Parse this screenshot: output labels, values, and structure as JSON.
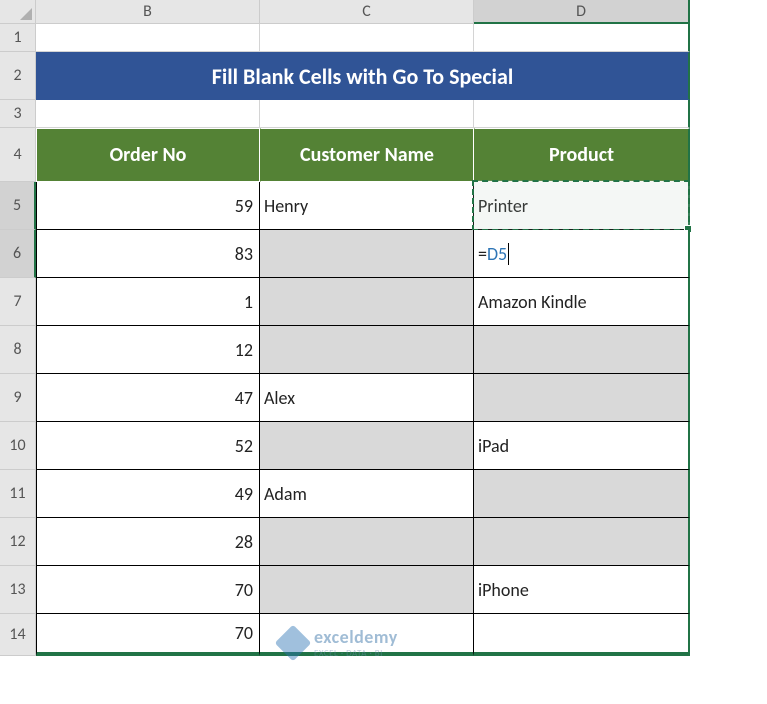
{
  "columns": [
    "B",
    "C",
    "D"
  ],
  "rows": [
    "1",
    "2",
    "3",
    "4",
    "5",
    "6",
    "7",
    "8",
    "9",
    "10",
    "11",
    "12",
    "13",
    "14"
  ],
  "title": "Fill Blank Cells with Go To Special",
  "headers": {
    "b": "Order No",
    "c": "Customer Name",
    "d": "Product"
  },
  "formula": {
    "eq": "=",
    "ref": "D5"
  },
  "data": {
    "r5": {
      "b": "59",
      "c": "Henry",
      "d": "Printer"
    },
    "r6": {
      "b": "83",
      "c": "",
      "d": ""
    },
    "r7": {
      "b": "1",
      "c": "",
      "d": "Amazon Kindle"
    },
    "r8": {
      "b": "12",
      "c": "",
      "d": ""
    },
    "r9": {
      "b": "47",
      "c": "Alex",
      "d": ""
    },
    "r10": {
      "b": "52",
      "c": "",
      "d": "iPad"
    },
    "r11": {
      "b": "49",
      "c": "Adam",
      "d": ""
    },
    "r12": {
      "b": "28",
      "c": "",
      "d": ""
    },
    "r13": {
      "b": "70",
      "c": "",
      "d": "iPhone"
    },
    "r14": {
      "b": "70",
      "c": "",
      "d": ""
    }
  },
  "watermark": {
    "brand": "exceldemy",
    "tagline": "EXCEL · DATA · BI"
  }
}
